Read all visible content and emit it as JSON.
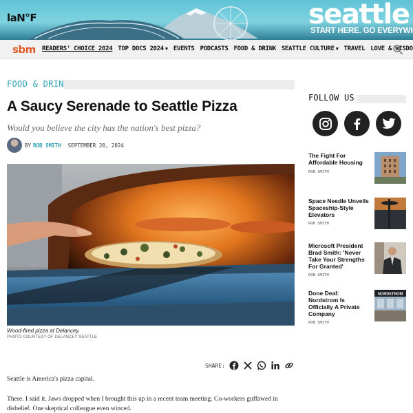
{
  "banner": {
    "left_logo": "laN°F",
    "title": "seattle",
    "tagline": "START HERE. GO EVERYWHERE"
  },
  "nav": {
    "brand": "sbm",
    "items": [
      {
        "label": "READERS' CHOICE 2024",
        "dropdown": false,
        "underline": true
      },
      {
        "label": "TOP DOCS 2024",
        "dropdown": true
      },
      {
        "label": "EVENTS",
        "dropdown": false
      },
      {
        "label": "PODCASTS",
        "dropdown": false
      },
      {
        "label": "FOOD & DRINK",
        "dropdown": false
      },
      {
        "label": "SEATTLE CULTURE",
        "dropdown": true
      },
      {
        "label": "TRAVEL",
        "dropdown": false
      },
      {
        "label": "LOVE & WISDOM",
        "dropdown": true
      }
    ],
    "search_icon": "search-icon"
  },
  "article": {
    "kicker": "FOOD & DRINK",
    "headline": "A Saucy Serenade to Seattle Pizza",
    "dek": "Would you believe the city has the nation's best pizza?",
    "byline_by": "BY",
    "author": "ROB SMITH",
    "date": "SEPTEMBER 20, 2024",
    "image_caption": "Wood-fired pizza at Delancey.",
    "image_credit": "PHOTO COURTESY OF DELANCEY SEATTLE",
    "share_label": "SHARE:",
    "share_icons": [
      "facebook-icon",
      "x-icon",
      "whatsapp-icon",
      "linkedin-icon",
      "link-icon"
    ],
    "paragraphs": [
      "Seattle is America's pizza capital.",
      "There. I said it. Jaws dropped when I brought this up in a recent team meeting. Co-workers guffawed in disbelief. One skeptical colleague even winced."
    ]
  },
  "sidebar": {
    "follow_label": "FOLLOW US",
    "social": [
      "instagram-icon",
      "facebook-icon",
      "twitter-icon"
    ],
    "stories": [
      {
        "title": "The Fight For Affordable Housing",
        "author": "ROB SMITH"
      },
      {
        "title": "Space Needle Unveils Spaceship-Style Elevators",
        "author": "ROB SMITH"
      },
      {
        "title": "Microsoft President Brad Smith: 'Never Take Your Strengths For Granted'",
        "author": "ROB SMITH"
      },
      {
        "title": "Done Deal: Nordstrom Is Officially A Private Company",
        "author": "ROB SMITH"
      }
    ],
    "nordstrom_sign": "NORDSTROM"
  },
  "colors": {
    "accent": "#2a9fb3",
    "brand_orange": "#e05a26",
    "nav_bg": "#f1f1f1"
  }
}
